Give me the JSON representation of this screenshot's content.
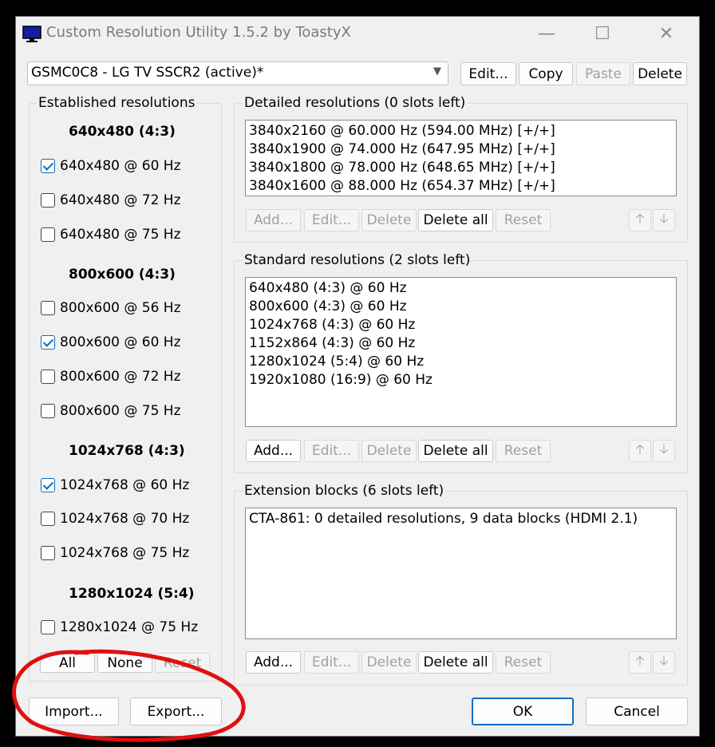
{
  "window": {
    "title": "Custom Resolution Utility 1.5.2 by ToastyX",
    "minimize": "—",
    "maximize": "☐",
    "close": "✕"
  },
  "display_combo": {
    "value": "GSMC0C8 - LG TV SSCR2 (active)*"
  },
  "top_buttons": {
    "edit": "Edit...",
    "copy": "Copy",
    "paste": "Paste",
    "delete": "Delete"
  },
  "established": {
    "label": "Established resolutions",
    "groups": [
      {
        "header": "640x480 (4:3)",
        "items": [
          {
            "label": "640x480 @ 60 Hz",
            "checked": true
          },
          {
            "label": "640x480 @ 72 Hz",
            "checked": false
          },
          {
            "label": "640x480 @ 75 Hz",
            "checked": false
          }
        ]
      },
      {
        "header": "800x600 (4:3)",
        "items": [
          {
            "label": "800x600 @ 56 Hz",
            "checked": false
          },
          {
            "label": "800x600 @ 60 Hz",
            "checked": true
          },
          {
            "label": "800x600 @ 72 Hz",
            "checked": false
          },
          {
            "label": "800x600 @ 75 Hz",
            "checked": false
          }
        ]
      },
      {
        "header": "1024x768 (4:3)",
        "items": [
          {
            "label": "1024x768 @ 60 Hz",
            "checked": true
          },
          {
            "label": "1024x768 @ 70 Hz",
            "checked": false
          },
          {
            "label": "1024x768 @ 75 Hz",
            "checked": false
          }
        ]
      },
      {
        "header": "1280x1024 (5:4)",
        "items": [
          {
            "label": "1280x1024 @ 75 Hz",
            "checked": false
          }
        ]
      }
    ],
    "buttons": {
      "all": "All",
      "none": "None",
      "reset": "Reset"
    }
  },
  "detailed": {
    "label": "Detailed resolutions (0 slots left)",
    "rows": [
      "3840x2160 @ 60.000 Hz (594.00 MHz) [+/+]",
      "3840x1900 @ 74.000 Hz (647.95 MHz) [+/+]",
      "3840x1800 @ 78.000 Hz (648.65 MHz) [+/+]",
      "3840x1600 @ 88.000 Hz (654.37 MHz) [+/+]"
    ],
    "buttons": {
      "add": "Add...",
      "edit": "Edit...",
      "delete": "Delete",
      "delete_all": "Delete all",
      "reset": "Reset"
    }
  },
  "standard": {
    "label": "Standard resolutions (2 slots left)",
    "rows": [
      "640x480 (4:3) @ 60 Hz",
      "800x600 (4:3) @ 60 Hz",
      "1024x768 (4:3) @ 60 Hz",
      "1152x864 (4:3) @ 60 Hz",
      "1280x1024 (5:4) @ 60 Hz",
      "1920x1080 (16:9) @ 60 Hz"
    ],
    "buttons": {
      "add": "Add...",
      "edit": "Edit...",
      "delete": "Delete",
      "delete_all": "Delete all",
      "reset": "Reset"
    }
  },
  "extension": {
    "label": "Extension blocks (6 slots left)",
    "rows": [
      "CTA-861: 0 detailed resolutions, 9 data blocks (HDMI 2.1)"
    ],
    "buttons": {
      "add": "Add...",
      "edit": "Edit...",
      "delete": "Delete",
      "delete_all": "Delete all",
      "reset": "Reset"
    }
  },
  "arrows": {
    "up": "🡡",
    "down": "🡣"
  },
  "bottom": {
    "import": "Import...",
    "export": "Export...",
    "ok": "OK",
    "cancel": "Cancel"
  },
  "colors": {
    "accent": "#0f6cbd",
    "annotation": "#e01010"
  }
}
